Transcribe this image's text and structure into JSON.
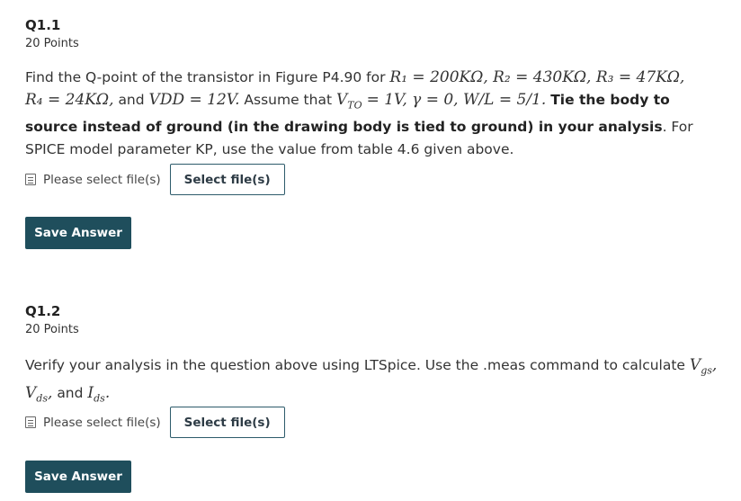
{
  "questions": [
    {
      "title": "Q1.1",
      "points": "20 Points",
      "prompt": {
        "find": "Find the Q-point of the transistor in Figure P4.90 for",
        "r1": "R₁ = 200KΩ, R₂ = 430KΩ, R₃ = 47KΩ,",
        "r4": "R₄ = 24KΩ,",
        "and": "and",
        "vdd": "VDD = 12V.",
        "assume": "Assume that",
        "vto": "V",
        "vto_sub": "TO",
        "cond": "= 1V,  γ = 0,  W/L = 5/1.",
        "bold": "Tie the body to source instead of ground (in the drawing body is tied to ground) in your analysis",
        "tail": ". For SPICE model parameter KP, use the value from table 4.6 given above."
      },
      "file_label": "Please select file(s)",
      "select_button": "Select file(s)",
      "save_button": "Save Answer"
    },
    {
      "title": "Q1.2",
      "points": "20 Points",
      "prompt": {
        "text": "Verify your analysis in the question above using LTSpice. Use the .meas command to calculate",
        "vgs": "V",
        "vgs_sub": "gs",
        "vds": "V",
        "vds_sub": "ds",
        "and": "and",
        "ids": "I",
        "ids_sub": "ds"
      },
      "file_label": "Please select file(s)",
      "select_button": "Select file(s)",
      "save_button": "Save Answer"
    }
  ],
  "icons": {
    "file": "file-doc-icon"
  },
  "colors": {
    "save_bg": "#1f4e5c",
    "select_border": "#2d5b6b"
  }
}
